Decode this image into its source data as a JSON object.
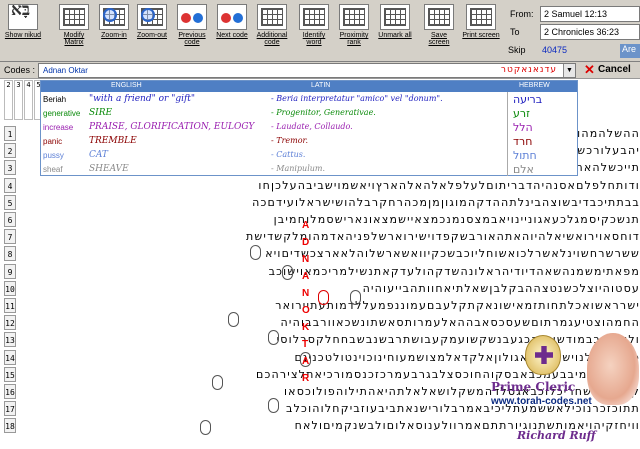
{
  "toolbar": {
    "buttons": [
      {
        "label": "Show nikud",
        "icon": "hebrew-nikud-icon"
      },
      {
        "label": "Modify Matrix",
        "icon": "grid-edit-icon"
      },
      {
        "label": "Zoom-in",
        "icon": "zoom-in-icon"
      },
      {
        "label": "Zoom-out",
        "icon": "zoom-out-icon"
      },
      {
        "label": "Previous code",
        "icon": "previous-code-icon"
      },
      {
        "label": "Next code",
        "icon": "next-code-icon"
      },
      {
        "label": "Additional code",
        "icon": "additional-code-icon"
      },
      {
        "label": "Identify word",
        "icon": "identify-word-icon"
      },
      {
        "label": "Proximity rank",
        "icon": "proximity-rank-icon"
      },
      {
        "label": "Unmark all",
        "icon": "unmark-all-icon"
      },
      {
        "label": "Save screen",
        "icon": "save-screen-icon"
      },
      {
        "label": "Print screen",
        "icon": "print-screen-icon"
      }
    ],
    "nikud_glyph": "בָּא",
    "from_label": "From:",
    "from_value": "2 Samuel 12:13",
    "to_label": "To",
    "to_value": "2 Chronicles 36:23",
    "skip_label": "Skip",
    "skip_value": "40475",
    "are_label": "Are"
  },
  "codes": {
    "label": "Codes :",
    "value": "Adnan Oktar",
    "hebrew": "עדנאנאקטר",
    "dropdown_arrow": "▼",
    "cancel_label": "Cancel"
  },
  "popup": {
    "headers": {
      "english": "ENGLISH",
      "latin": "LATIN",
      "hebrew": "HEBREW"
    },
    "rows": [
      {
        "en": "Beriah",
        "translation": "\"with a friend\" or \"gift\"",
        "latin": "- Beria interpretatur \"amico\" vel \"donum\".",
        "hebrew": "בריעה",
        "color": "#1f1fbf"
      },
      {
        "en": "generative",
        "translation": "SIRE",
        "latin": "- Progenitor, Generativae.",
        "hebrew": "זרע",
        "color": "#0a8a0a"
      },
      {
        "en": "increase",
        "translation": "PRAISE, GLORIFICATION, EULOGY",
        "latin": "- Laudate, Collaudo.",
        "hebrew": "הלל",
        "color": "#9a20b0"
      },
      {
        "en": "panic",
        "translation": "TREMBLE",
        "latin": "- Tremor.",
        "hebrew": "חרד",
        "color": "#8b0000"
      },
      {
        "en": "pussy",
        "translation": "CAT",
        "latin": "- Cattus.",
        "hebrew": "חתול",
        "color": "#5c7fd6"
      },
      {
        "en": "sheaf",
        "translation": "SHEAVE",
        "latin": "- Manipulum.",
        "hebrew": "אלם",
        "color": "#8a8a8a"
      }
    ]
  },
  "grid": {
    "row_numbers": [
      "1",
      "2",
      "3",
      "4",
      "5",
      "6",
      "7",
      "8",
      "9",
      "10",
      "11",
      "12",
      "13",
      "14",
      "15",
      "16",
      "17",
      "18"
    ],
    "col_header_digits": [
      "2",
      "3",
      "4",
      "5",
      "6",
      "7",
      "8",
      "9"
    ],
    "lines": [
      "ההשלהמהוראבלטםיאלוהתכשמלאלוהם",
      "יהבעלורכשלאמנתולדבשמיהנהיביאו",
      "תייכשלהאחריךישמושהלרמאתוקקלנה",
      "ודותחלפלםאסנהיהדבריתוםלעלפלאלהאלהארץויאשמוישביבהעלכןחו",
      "בבתתיכבדיבשוצהבינלתההדקהמוגוןמןמכהרחקרבלהושישראלועידםכה",
      "תנשכקיסמגלכעאגוניינויאבמצסנמנכמצאיישמצאונארישסמלוחמיבן",
      "דוחסאוירואשיאלהיוהאתהאורבשקפדוישירוארשלפניהאדמהומלקשדישת",
      "ששרשרחשוינלאשרלכואשוחליוכבשכקיוואשארשלוהלאארצכשדיםויא",
      "מפאתימשמנהשאהדיודיהראלונהשדקהולעדקאתנשילמריכמאוישוכב",
      "עסטוהיוצלכשנטצההבקלבןשאלתיאחוותהבייעוהיה",
      "ישרראשואכלתחותזמאישונאקתקלעבםעמוננפמעללדמותעתיירואר",
      "החמהוצטיעגמרתוםשעסכסאבההאלעמרותסאשתונשכאוורבבוהיה",
      "ולאבליבבמודשושוהכגעבנשקשועמקעבושתרבשנבשבחחלקסרלוסי",
      "כריחשפולנוישויקחאאגולוןאלקדאלמצושמעוחינוכוינטולטכנינם",
      "ליעהאלשמיבבעמכבאבסקוהחוכסצלבגרבעמרכזכנסמורכיאתלצירהכם",
      "קשוהאמשחריכלוכבאגסלדהמשקלושאלאלתהיאהתילוהפולוכסאו",
      "תתוכזכרנוכילאששמעתליכיבאמרבלורישנאתביבעוזביקחלוהוכלב",
      "וויחזקיהויאמותשתנוגיורתתםאמרוולענוסאלוםולבשנקמיםולאח"
    ],
    "found_letters": [
      "A",
      "D",
      "N",
      "A",
      "N",
      "O",
      "K",
      "T",
      "A",
      "R"
    ]
  },
  "badge": {
    "title": "Prime Cleric",
    "url": "www.torah-codes.net",
    "signature": "Richard Ruff"
  }
}
